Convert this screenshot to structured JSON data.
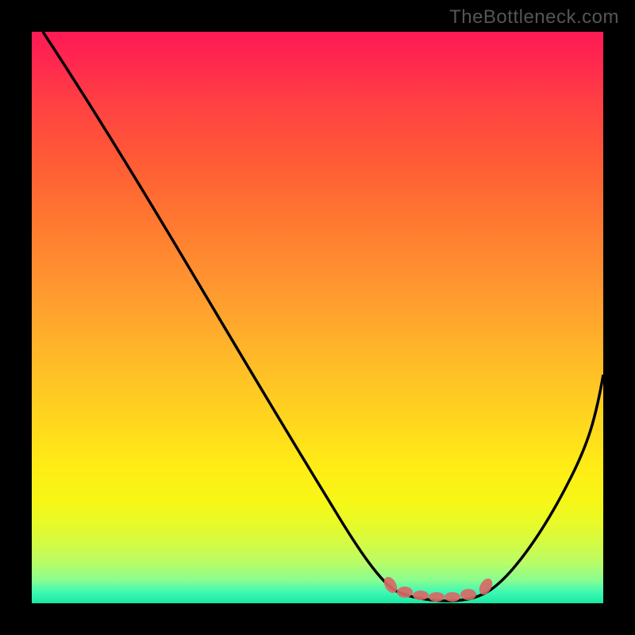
{
  "watermark": "TheBottleneck.com",
  "chart_data": {
    "type": "line",
    "title": "",
    "xlabel": "",
    "ylabel": "",
    "xlim": [
      0,
      100
    ],
    "ylim": [
      0,
      100
    ],
    "series": [
      {
        "name": "curve",
        "x": [
          2,
          10,
          20,
          30,
          40,
          50,
          56,
          60,
          63,
          65,
          68,
          72,
          76,
          80,
          83,
          88,
          94,
          100
        ],
        "values": [
          100,
          88,
          73,
          58,
          43,
          28,
          18,
          12,
          6,
          3,
          1,
          0,
          0,
          2,
          5,
          12,
          24,
          40
        ]
      }
    ],
    "markers": {
      "name": "highlight-band",
      "x": [
        63,
        66,
        69,
        72,
        75,
        78,
        80
      ],
      "values": [
        3.5,
        2.5,
        2.0,
        2.0,
        2.0,
        2.5,
        3.5
      ],
      "color": "#d96a66"
    },
    "gradient_stops": [
      {
        "pos": 0,
        "color": "#ff1a56"
      },
      {
        "pos": 50,
        "color": "#ffab2c"
      },
      {
        "pos": 80,
        "color": "#ffec16"
      },
      {
        "pos": 100,
        "color": "#18e9a0"
      }
    ]
  }
}
